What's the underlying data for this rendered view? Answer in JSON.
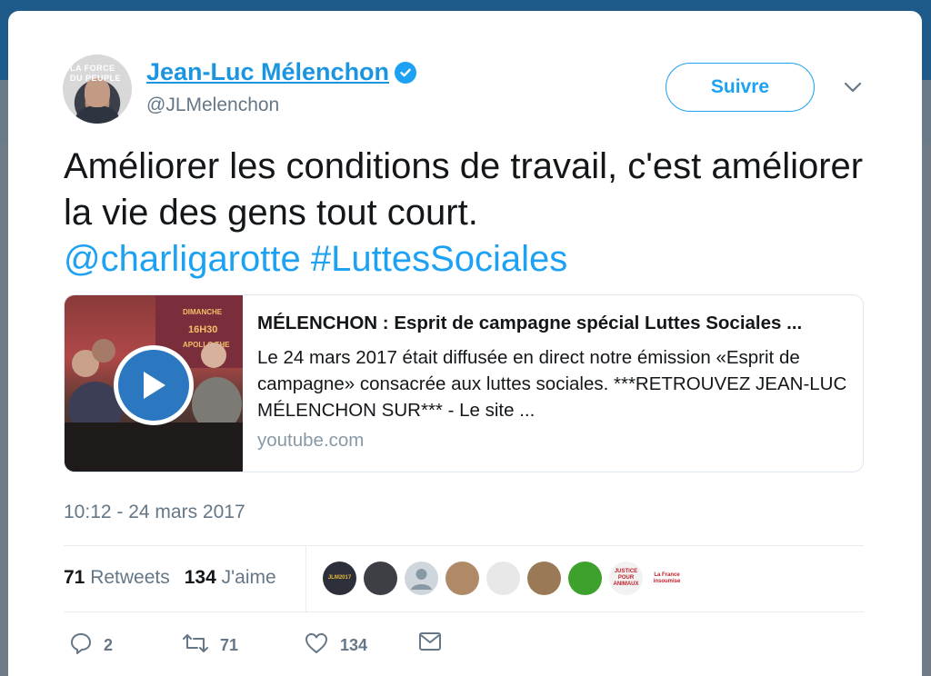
{
  "author": {
    "name": "Jean-Luc Mélenchon",
    "handle": "@JLMelenchon",
    "avatar_text": "LA FORCE DU PEUPLE",
    "verified": true
  },
  "follow_button": {
    "label": "Suivre"
  },
  "tweet": {
    "text": "Améliorer les conditions de travail, c'est améliorer la vie des gens tout court.",
    "mention": "@charligarotte",
    "hashtag": "#LuttesSociales"
  },
  "link_card": {
    "title": "MÉLENCHON : Esprit de campagne spécial Luttes Sociales ...",
    "description": "Le 24 mars 2017 était diffusée en direct notre émission «Esprit de campagne» consacrée aux luttes sociales. ***RETROUVEZ JEAN-LUC MÉLENCHON SUR*** - Le site ...",
    "domain": "youtube.com",
    "poster_text": [
      "DIMANCHE",
      "16H30",
      "APOLLO THE"
    ]
  },
  "timestamp": "10:12 - 24 mars 2017",
  "stats": {
    "retweets_count": "71",
    "retweets_label": "Retweets",
    "likes_count": "134",
    "likes_label": "J'aime"
  },
  "likers": [
    {
      "name": "liker-1",
      "text": "JLM2017",
      "color": "#2d2f3a"
    },
    {
      "name": "liker-2",
      "text": "",
      "color": "#3d3f45"
    },
    {
      "name": "liker-3",
      "text": "",
      "color": "#cfd6dc"
    },
    {
      "name": "liker-4",
      "text": "",
      "color": "#b08a66"
    },
    {
      "name": "liker-5",
      "text": "",
      "color": "#e8e8e8"
    },
    {
      "name": "liker-6",
      "text": "",
      "color": "#9a7a56"
    },
    {
      "name": "liker-7",
      "text": "",
      "color": "#3ea12e"
    },
    {
      "name": "liker-8",
      "text": "JUSTICE POUR ANIMAUX",
      "color": "#f2f2f2"
    },
    {
      "name": "liker-9",
      "text": "La France insoumise",
      "color": "#ffffff"
    }
  ],
  "actions": {
    "reply_count": "2",
    "retweet_count": "71",
    "like_count": "134"
  },
  "colors": {
    "accent": "#1da1f2",
    "link": "#1b95e0",
    "muted": "#657786"
  }
}
